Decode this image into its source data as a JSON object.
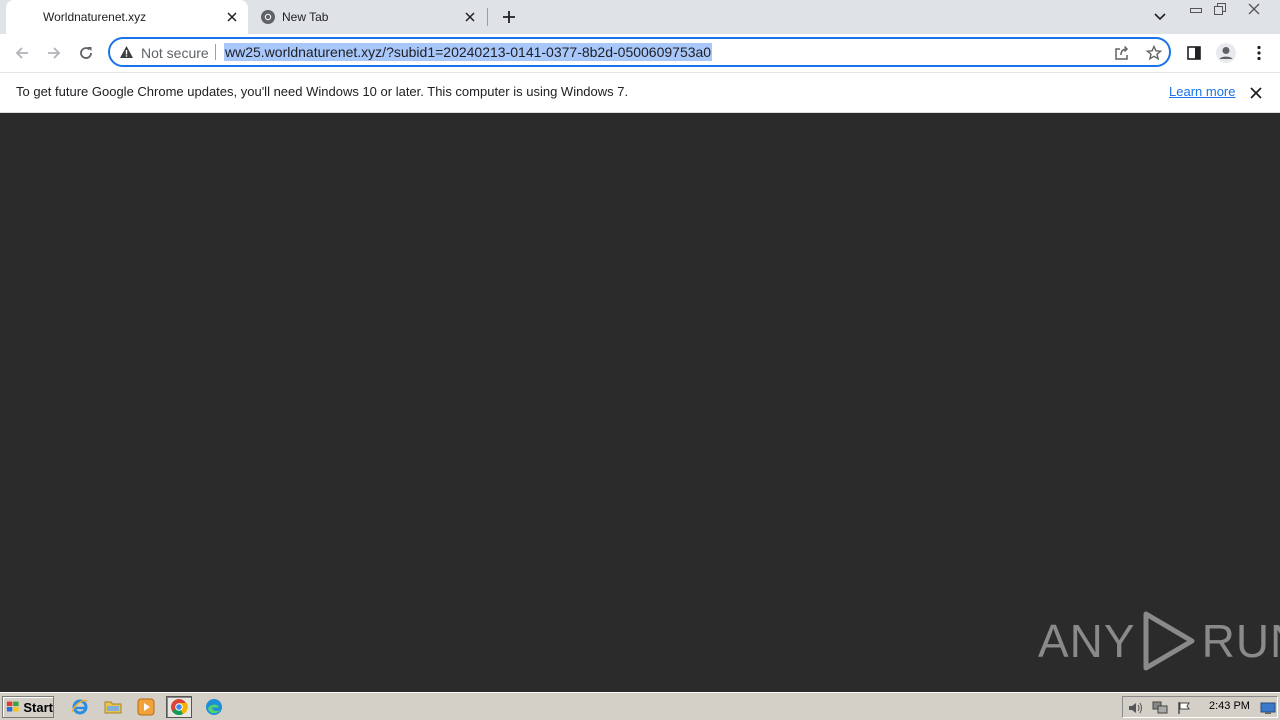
{
  "tabs": [
    {
      "title": "Worldnaturenet.xyz",
      "active": true
    },
    {
      "title": "New Tab",
      "active": false
    }
  ],
  "omnibox": {
    "security_label": "Not secure",
    "url": "ww25.worldnaturenet.xyz/?subid1=20240213-0141-0377-8b2d-0500609753a0"
  },
  "infobar": {
    "message": "To get future Google Chrome updates, you'll need Windows 10 or later. This computer is using Windows 7.",
    "link": "Learn more"
  },
  "watermark": {
    "left": "ANY",
    "right": "RUN"
  },
  "taskbar": {
    "start_label": "Start",
    "clock": "2:43 PM",
    "apps": [
      "internet-explorer-icon",
      "file-explorer-icon",
      "media-player-icon",
      "chrome-icon",
      "edge-icon"
    ]
  },
  "colors": {
    "accent": "#1a73e8",
    "selection": "#a8c7fa",
    "content_bg": "#2b2b2b",
    "tabstrip_bg": "#dfe3e8"
  }
}
